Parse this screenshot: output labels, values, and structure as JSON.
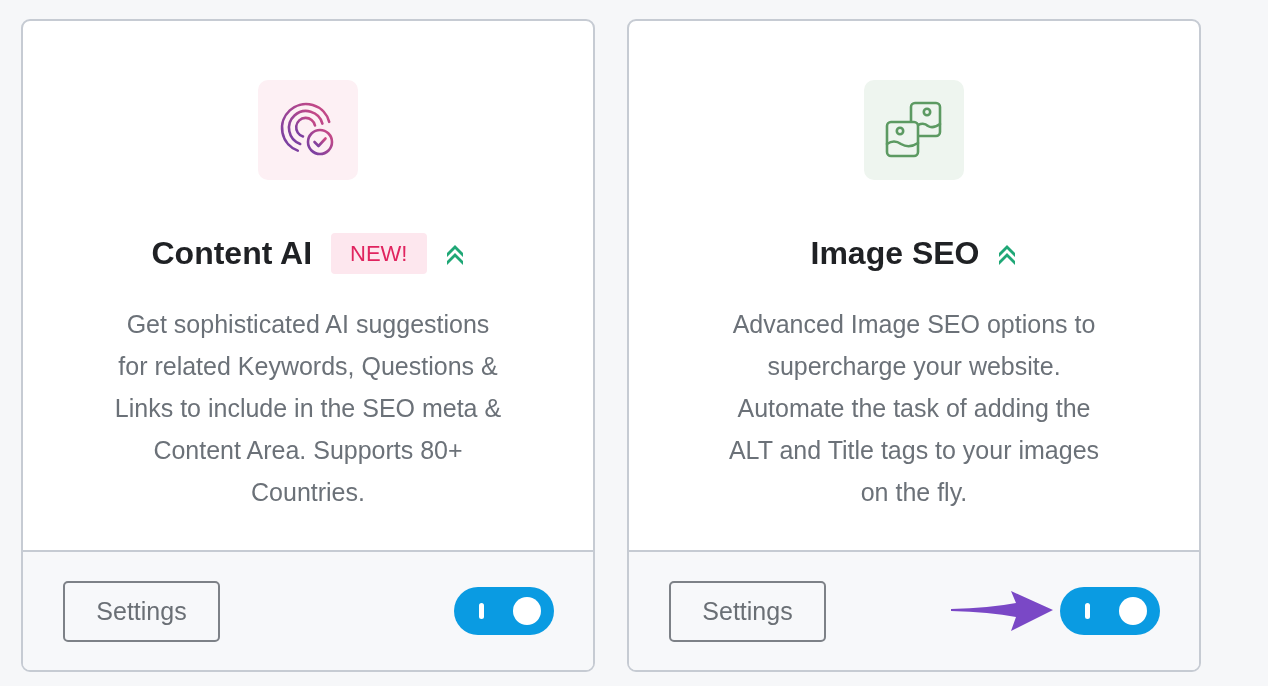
{
  "modules": [
    {
      "kind": "ai",
      "title": "Content AI",
      "badge": "NEW!",
      "pro": true,
      "description": "Get sophisticated AI suggestions for related Keywords, Questions & Links to include in the SEO meta & Content Area. Supports 80+ Countries.",
      "button": "Settings",
      "on": true,
      "pointed": false
    },
    {
      "kind": "image",
      "title": "Image SEO",
      "pro": true,
      "description": "Advanced Image SEO options to supercharge your website. Automate the task of adding the ALT and Title tags to your images on the fly.",
      "button": "Settings",
      "on": true,
      "pointed": true
    }
  ]
}
